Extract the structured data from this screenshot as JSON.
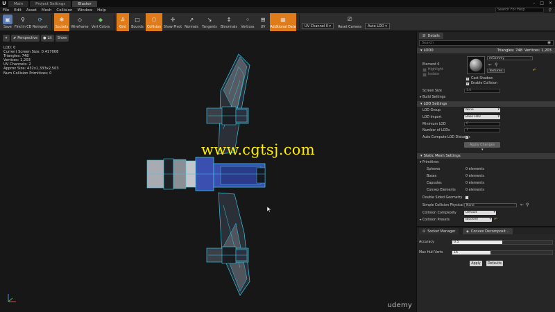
{
  "titlebar": {
    "tabs": [
      {
        "label": "Main"
      },
      {
        "label": "Project Settings"
      },
      {
        "label": "Blaster"
      }
    ]
  },
  "menubar": {
    "items": [
      "File",
      "Edit",
      "Asset",
      "Mesh",
      "Collision",
      "Window",
      "Help"
    ],
    "search_placeholder": "Search For Help"
  },
  "toolbar": {
    "buttons": [
      {
        "label": "Save",
        "on": false,
        "icon": "save-icon"
      },
      {
        "label": "Find in CB",
        "on": false,
        "icon": "magnifier-icon"
      },
      {
        "label": "Reimport",
        "on": false,
        "icon": "reimport-icon"
      },
      {
        "label": "Sockets",
        "on": true,
        "icon": "sockets-icon"
      },
      {
        "label": "Wireframe",
        "on": false,
        "icon": "wireframe-icon"
      },
      {
        "label": "Vert Colors",
        "on": false,
        "icon": "vertex-colors-icon"
      },
      {
        "label": "Grid",
        "on": true,
        "icon": "grid-icon"
      },
      {
        "label": "Bounds",
        "on": false,
        "icon": "bounds-icon"
      },
      {
        "label": "Collision",
        "on": true,
        "icon": "collision-icon"
      },
      {
        "label": "Show Pivot",
        "on": false,
        "icon": "pivot-icon"
      },
      {
        "label": "Normals",
        "on": false,
        "icon": "normals-icon"
      },
      {
        "label": "Tangents",
        "on": false,
        "icon": "tangents-icon"
      },
      {
        "label": "Binormals",
        "on": false,
        "icon": "binormals-icon"
      },
      {
        "label": "Vertices",
        "on": false,
        "icon": "vertices-icon"
      },
      {
        "label": "UV",
        "on": false,
        "icon": "uv-icon"
      },
      {
        "label": "Additional Data",
        "on": true,
        "icon": "additional-data-icon"
      }
    ],
    "uv_channel": "UV Channel 0",
    "reset_camera": "Reset Camera",
    "auto_lod": "Auto LOD"
  },
  "viewport": {
    "perspective": "Perspective",
    "lit": "Lit",
    "show": "Show",
    "stats": [
      "LOD:  0",
      "Current Screen Size:  0.417008",
      "Triangles:  748",
      "Vertices:  1,203",
      "UV Channels:  2",
      "Approx Size: 432x1,333x2,503",
      "Num Collision Primitives:  0"
    ],
    "watermark": "www.cgtsj.com",
    "brand": "udemy"
  },
  "details": {
    "tab_label": "Details",
    "search_placeholder": "Search",
    "lod_category": "LOD0",
    "triangles": "Triangles: 748",
    "vertices": "Vertices: 1,203",
    "material_name": "mGammy",
    "element_label": "Element 0",
    "highlight_label": "Highlight",
    "isolate_label": "Isolate",
    "textures_label": "Textures",
    "cast_shadow_label": "Cast Shadow",
    "enable_collision_label": "Enable Collision",
    "screen_size_label": "Screen Size",
    "screen_size_value": "1.0",
    "build_settings_label": "Build Settings",
    "lod_settings_category": "LOD Settings",
    "lod_group_label": "LOD Group",
    "lod_group_value": "None",
    "lod_import_label": "LOD Import",
    "lod_import_value": "Base LOD",
    "minimum_lod_label": "Minimum LOD",
    "minimum_lod_value": "0",
    "number_of_lods_label": "Number of LODs",
    "number_of_lods_value": "1",
    "auto_compute_label": "Auto Compute LOD Distance",
    "apply_changes_label": "Apply Changes",
    "static_mesh_category": "Static Mesh Settings",
    "primitives_label": "Primitives",
    "spheres_label": "Spheres",
    "spheres_value": "0 elements",
    "boxes_label": "Boxes",
    "boxes_value": "0 elements",
    "capsules_label": "Capsules",
    "capsules_value": "0 elements",
    "convex_label": "Convex Elements",
    "convex_value": "0 elements",
    "double_sided_label": "Double Sided Geometry",
    "simple_collision_label": "Simple Collision Physical M...",
    "simple_collision_value": "None",
    "collision_complexity_label": "Collision Complexity",
    "collision_complexity_value": "Default",
    "collision_presets_label": "Collision Presets",
    "collision_presets_value": "BlockAll"
  },
  "bottom": {
    "tabs": [
      "Socket Manager",
      "Convex Decomposit..."
    ],
    "accuracy_label": "Accuracy",
    "accuracy_value": "0.5",
    "accuracy_fraction": 0.5,
    "max_hull_label": "Max Hull Verts",
    "max_hull_value": "16",
    "max_hull_fraction": 0.38,
    "apply_label": "Apply",
    "defaults_label": "Defaults"
  },
  "colors": {
    "accent": "#e07b1a",
    "wire": "#36c8e6",
    "mesh_blue": "#3a4fb0",
    "watermark": "#ffee00"
  }
}
